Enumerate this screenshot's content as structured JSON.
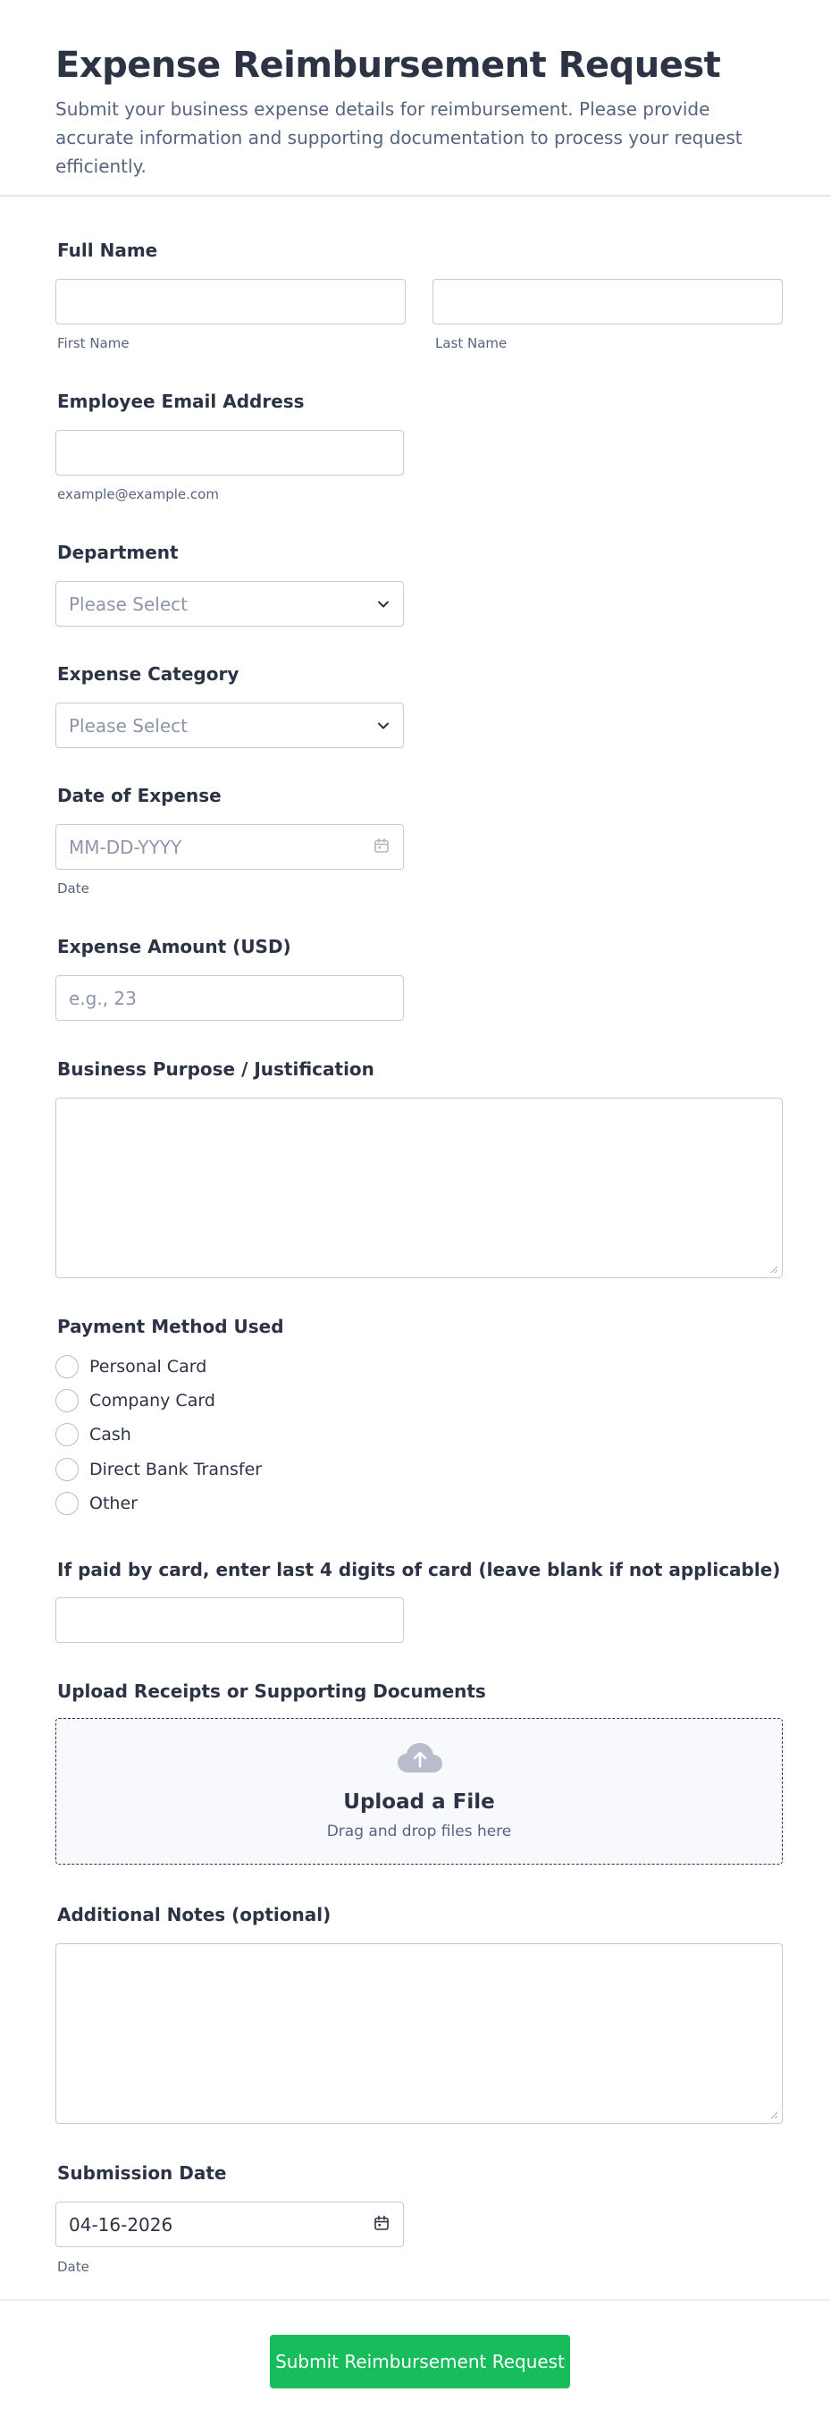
{
  "header": {
    "title": "Expense Reimbursement Request",
    "subtitle": "Submit your business expense details for reimbursement. Please provide accurate information and supporting documentation to process your request efficiently."
  },
  "full_name": {
    "label": "Full Name",
    "first_sublabel": "First Name",
    "last_sublabel": "Last Name",
    "first_value": "",
    "last_value": ""
  },
  "email": {
    "label": "Employee Email Address",
    "sublabel": "example@example.com",
    "value": ""
  },
  "department": {
    "label": "Department",
    "selected": "Please Select"
  },
  "expense_category": {
    "label": "Expense Category",
    "selected": "Please Select"
  },
  "expense_date": {
    "label": "Date of Expense",
    "placeholder": "MM-DD-YYYY",
    "sublabel": "Date"
  },
  "amount": {
    "label": "Expense Amount (USD)",
    "placeholder": "e.g., 23"
  },
  "purpose": {
    "label": "Business Purpose / Justification"
  },
  "payment_method": {
    "label": "Payment Method Used",
    "options": [
      "Personal Card",
      "Company Card",
      "Cash",
      "Direct Bank Transfer",
      "Other"
    ]
  },
  "card_digits": {
    "label": "If paid by card, enter last 4 digits of card (leave blank if not applicable)"
  },
  "upload": {
    "label": "Upload Receipts or Supporting Documents",
    "title": "Upload a File",
    "subtitle": "Drag and drop files here",
    "icon": "cloud-upload-icon"
  },
  "notes": {
    "label": "Additional Notes (optional)"
  },
  "submission_date": {
    "label": "Submission Date",
    "value": "04-16-2026",
    "sublabel": "Date"
  },
  "submit": {
    "label": "Submit Reimbursement Request"
  },
  "colors": {
    "accent": "#18bd5b",
    "text": "#2c3345",
    "muted": "#57647e",
    "border": "#c3cad8"
  }
}
